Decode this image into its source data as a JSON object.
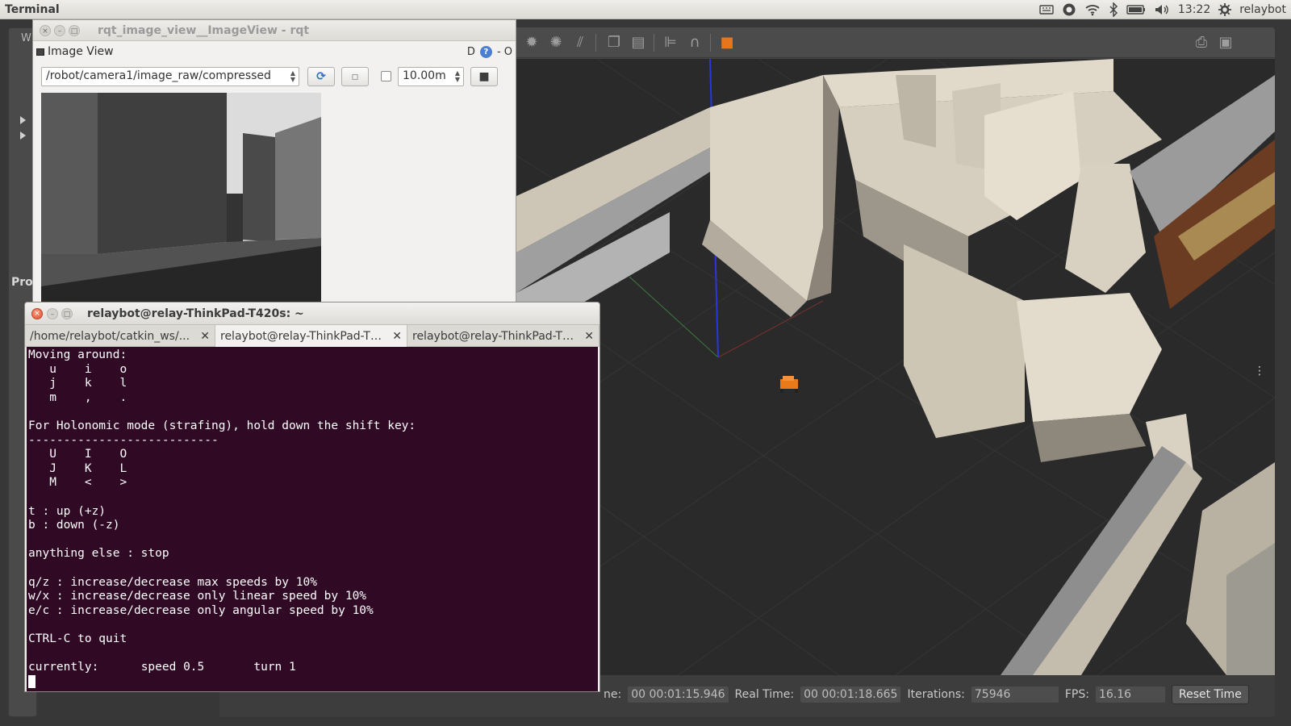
{
  "top_panel": {
    "title": "Terminal",
    "clock": "13:22",
    "user": "relaybot"
  },
  "launcher": {
    "partial_label": "Pro",
    "partial_w": "W"
  },
  "rqt": {
    "window_title": "rqt_image_view__ImageView - rqt",
    "panel_title": "Image View",
    "panel_right_label": "D",
    "panel_right_min": "- O",
    "topic": "/robot/camera1/image_raw/compressed",
    "range_value": "10.00m"
  },
  "terminal": {
    "window_title": "relaybot@relay-ThinkPad-T420s: ~",
    "tabs": [
      {
        "label": "/home/relaybot/catkin_ws/...",
        "active": false
      },
      {
        "label": "relaybot@relay-ThinkPad-T4...",
        "active": true
      },
      {
        "label": "relaybot@relay-ThinkPad-T4...",
        "active": false
      }
    ],
    "lines": [
      "Moving around:",
      "   u    i    o",
      "   j    k    l",
      "   m    ,    .",
      "",
      "For Holonomic mode (strafing), hold down the shift key:",
      "---------------------------",
      "   U    I    O",
      "   J    K    L",
      "   M    <    >",
      "",
      "t : up (+z)",
      "b : down (-z)",
      "",
      "anything else : stop",
      "",
      "q/z : increase/decrease max speeds by 10%",
      "w/x : increase/decrease only linear speed by 10%",
      "e/c : increase/decrease only angular speed by 10%",
      "",
      "CTRL-C to quit",
      "",
      "currently:\tspeed 0.5\tturn 1"
    ]
  },
  "gazebo": {
    "sim_time_label_fragment": "ne:",
    "sim_time": "00 00:01:15.946",
    "real_time_label": "Real Time:",
    "real_time": "00 00:01:18.665",
    "iterations_label": "Iterations:",
    "iterations": "75946",
    "fps_label": "FPS:",
    "fps": "16.16",
    "reset_label": "Reset Time",
    "colors": {
      "floor": "#2a2a2a",
      "walls": "#d9d2c3",
      "robot": "#e87a1a",
      "axis_z": "#1f2ce0"
    }
  }
}
